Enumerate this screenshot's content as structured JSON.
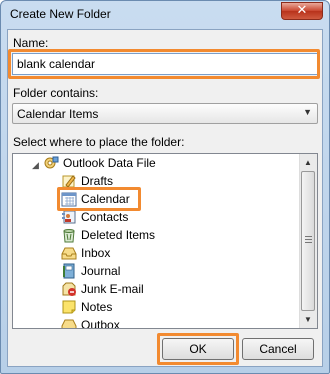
{
  "window": {
    "title": "Create New Folder",
    "close_label": "✕"
  },
  "name_field": {
    "label": "Name:",
    "value": "blank calendar"
  },
  "folder_contains": {
    "label": "Folder contains:",
    "value": "Calendar Items"
  },
  "tree": {
    "label": "Select where to place the folder:",
    "root": "Outlook Data File",
    "items": [
      {
        "label": "Drafts",
        "icon": "drafts-icon"
      },
      {
        "label": "Calendar",
        "icon": "calendar-icon"
      },
      {
        "label": "Contacts",
        "icon": "contacts-icon"
      },
      {
        "label": "Deleted Items",
        "icon": "deleted-items-icon"
      },
      {
        "label": "Inbox",
        "icon": "inbox-icon"
      },
      {
        "label": "Journal",
        "icon": "journal-icon"
      },
      {
        "label": "Junk E-mail",
        "icon": "junk-email-icon"
      },
      {
        "label": "Notes",
        "icon": "notes-icon"
      },
      {
        "label": "Outbox",
        "icon": "outbox-icon"
      }
    ]
  },
  "buttons": {
    "ok": "OK",
    "cancel": "Cancel"
  },
  "colors": {
    "highlight": "#f28a30",
    "title_bar": "#b7cfe8",
    "close": "#c9452e"
  }
}
